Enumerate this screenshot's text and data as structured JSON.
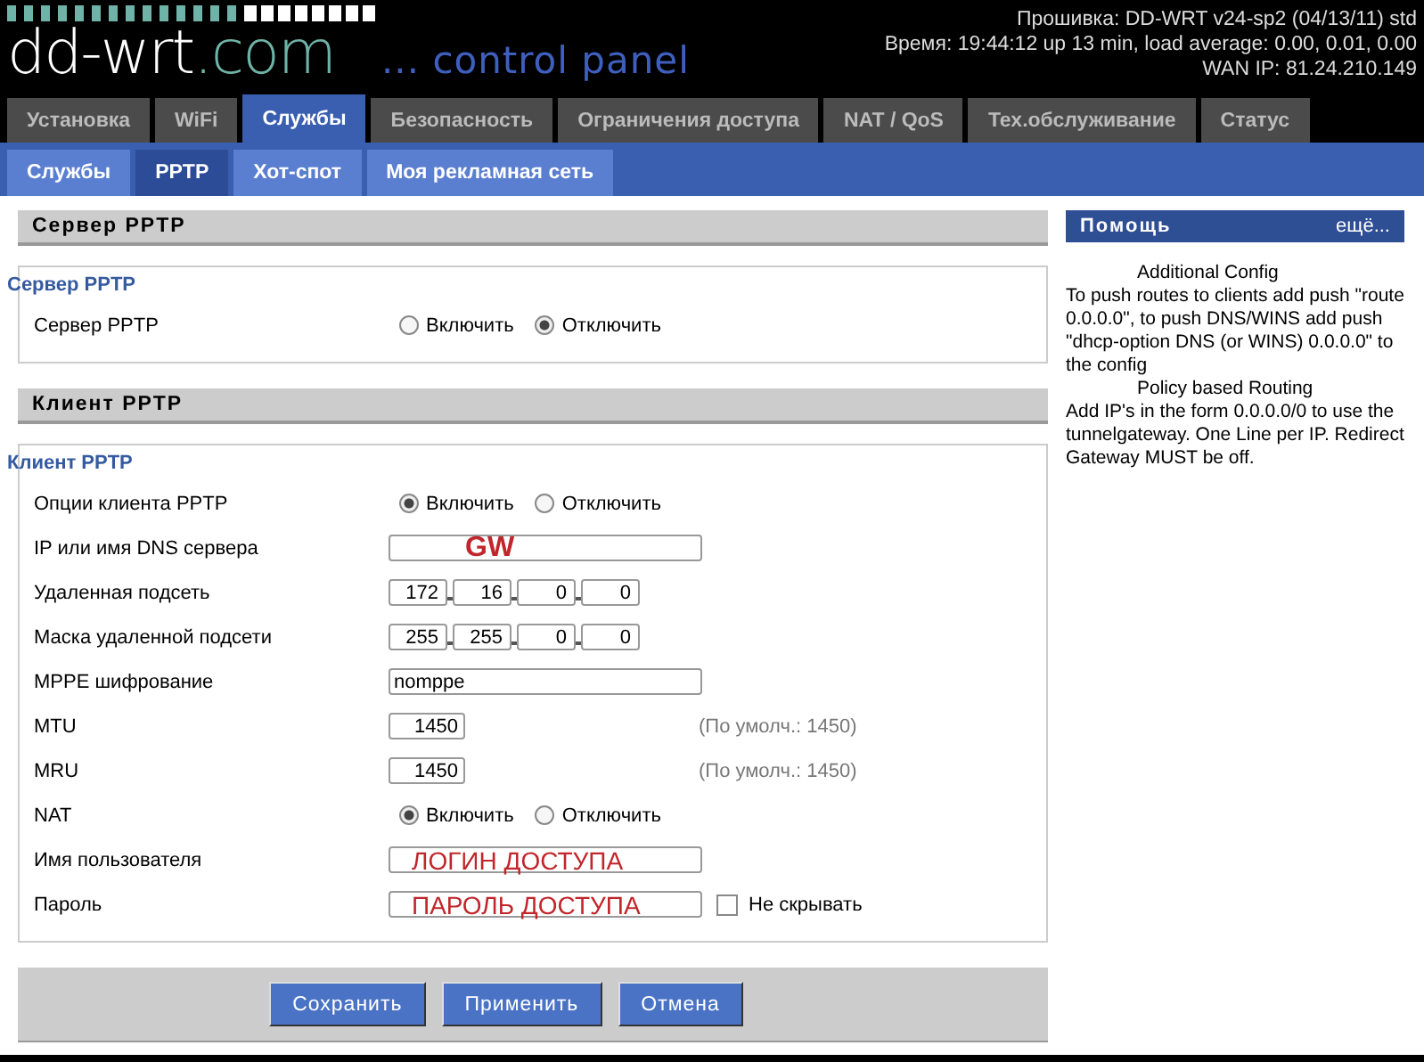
{
  "header": {
    "logo_main": "dd-wrt",
    "logo_suffix": ".com",
    "tagline": "... control panel",
    "info": [
      "Прошивка: DD-WRT v24-sp2 (04/13/11) std",
      "Время: 19:44:12 up 13 min, load average: 0.00, 0.01, 0.00",
      "WAN IP: 81.24.210.149"
    ]
  },
  "main_tabs": [
    {
      "label": "Установка",
      "selected": false
    },
    {
      "label": "WiFi",
      "selected": false
    },
    {
      "label": "Службы",
      "selected": true
    },
    {
      "label": "Безопасность",
      "selected": false
    },
    {
      "label": "Ограничения доступа",
      "selected": false
    },
    {
      "label": "NAT / QoS",
      "selected": false
    },
    {
      "label": "Тех.обслуживание",
      "selected": false
    },
    {
      "label": "Статус",
      "selected": false
    }
  ],
  "sub_tabs": [
    {
      "label": "Службы",
      "selected": false
    },
    {
      "label": "PPTP",
      "selected": true
    },
    {
      "label": "Хот-спот",
      "selected": false
    },
    {
      "label": "Моя рекламная сеть",
      "selected": false
    }
  ],
  "sections": [
    {
      "title": "Сервер PPTP",
      "legend": "Сервер PPTP",
      "rows": [
        {
          "kind": "radio",
          "label": "Сервер PPTP",
          "options": [
            {
              "label": "Включить",
              "selected": false
            },
            {
              "label": "Отключить",
              "selected": true
            }
          ]
        }
      ]
    },
    {
      "title": "Клиент PPTP",
      "legend": "Клиент PPTP",
      "rows": [
        {
          "kind": "radio",
          "label": "Опции клиента PPTP",
          "options": [
            {
              "label": "Включить",
              "selected": true
            },
            {
              "label": "Отключить",
              "selected": false
            }
          ]
        },
        {
          "kind": "text",
          "label": "IP или имя DNS сервера",
          "value": "GW",
          "annotated": true
        },
        {
          "kind": "ip",
          "label": "Удаленная подсеть",
          "octets": [
            "172",
            "16",
            "0",
            "0"
          ]
        },
        {
          "kind": "ip",
          "label": "Маска удаленной подсети",
          "octets": [
            "255",
            "255",
            "0",
            "0"
          ]
        },
        {
          "kind": "text",
          "label": "MPPE шифрование",
          "value": "nomppe",
          "annotated": false
        },
        {
          "kind": "number",
          "label": "MTU",
          "value": "1450",
          "hint": "(По умолч.: 1450)"
        },
        {
          "kind": "number",
          "label": "MRU",
          "value": "1450",
          "hint": "(По умолч.: 1450)"
        },
        {
          "kind": "radio",
          "label": "NAT",
          "options": [
            {
              "label": "Включить",
              "selected": true
            },
            {
              "label": "Отключить",
              "selected": false
            }
          ]
        },
        {
          "kind": "text",
          "label": "Имя пользователя",
          "value": "ЛОГИН ДОСТУПА",
          "annotated": true
        },
        {
          "kind": "password",
          "label": "Пароль",
          "value": "ПАРОЛЬ ДОСТУПА",
          "annotated": true,
          "unmask_label": "Не скрывать",
          "checked": false
        }
      ]
    }
  ],
  "help": {
    "title": "Помощь",
    "more": "ещё...",
    "paragraphs": [
      {
        "kind": "heading",
        "text": "Additional Config"
      },
      {
        "kind": "text",
        "text": "To push routes to clients add push \"route 0.0.0.0\", to push DNS/WINS add push \"dhcp-option DNS (or WINS) 0.0.0.0\" to the config"
      },
      {
        "kind": "heading",
        "text": "Policy based Routing"
      },
      {
        "kind": "text",
        "text": "Add IP's in the form 0.0.0.0/0 to use the tunnelgateway. One Line per IP. Redirect Gateway MUST be off."
      }
    ]
  },
  "buttons": [
    "Сохранить",
    "Применить",
    "Отмена"
  ]
}
